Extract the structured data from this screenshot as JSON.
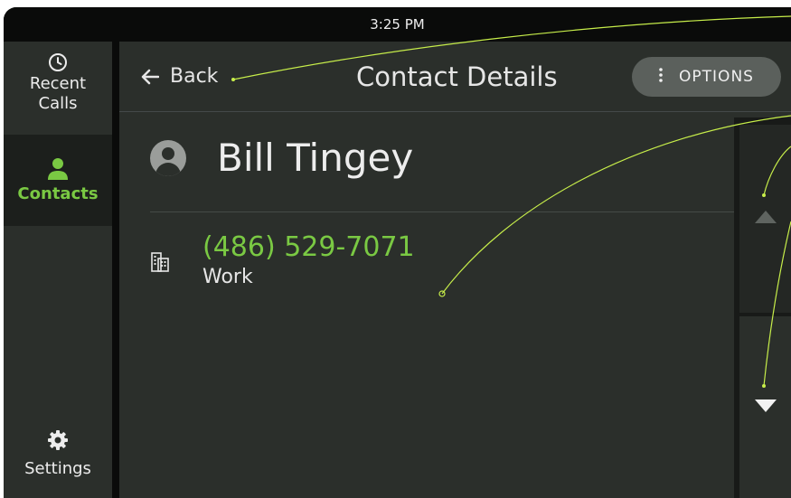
{
  "status_bar": {
    "time": "3:25 PM"
  },
  "sidebar": {
    "items": [
      {
        "label_line1": "Recent",
        "label_line2": "Calls",
        "icon": "clock-icon"
      },
      {
        "label": "Contacts",
        "icon": "person-icon",
        "active": true
      },
      {
        "label": "Settings",
        "icon": "gear-icon"
      }
    ]
  },
  "header": {
    "back_label": "Back",
    "title": "Contact Details",
    "options_label": "OPTIONS"
  },
  "contact": {
    "name": "Bill Tingey",
    "phones": [
      {
        "number": "(486) 529-7071",
        "type": "Work",
        "icon": "building-icon"
      }
    ]
  },
  "scroll": {
    "up_icon": "triangle-up-icon",
    "down_icon": "triangle-down-icon"
  },
  "colors": {
    "accent": "#7ac943",
    "panel": "#2b2f2b",
    "status_bar": "#0a0b0a",
    "annotation_line": "#c7ee4a"
  }
}
